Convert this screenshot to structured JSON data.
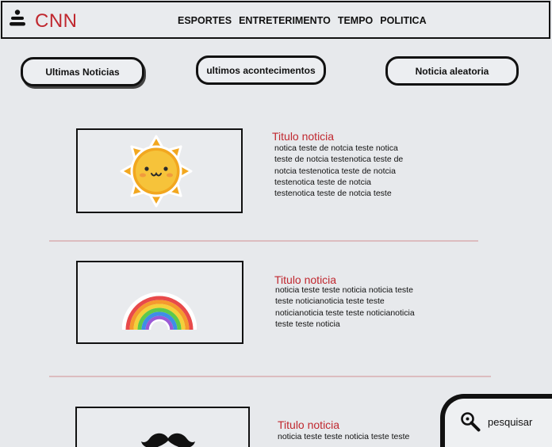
{
  "header": {
    "logo": "CNN",
    "nav": [
      "ESPORTES",
      "ENTRETERIMENTO",
      "TEMPO",
      "POLITICA"
    ]
  },
  "tabs": [
    "Ultimas Noticias",
    "ultimos acontecimentos",
    "Noticia aleatoria"
  ],
  "news": [
    {
      "title": "Titulo noticia",
      "body": [
        "notica teste de notcia teste notica",
        "teste de notcia testenotica teste de",
        "notcia testenotica teste de notcia",
        "testenotica teste de notcia",
        "testenotica teste de notcia teste"
      ],
      "image_icon": "sun-icon"
    },
    {
      "title": "Titulo noticia",
      "body": [
        "noticia teste teste noticia noticia teste",
        "teste noticianoticia teste teste",
        "noticianoticia teste teste noticianoticia",
        "teste teste noticia"
      ],
      "image_icon": "rainbow-icon"
    },
    {
      "title": "Titulo noticia",
      "body": [
        "noticia teste teste noticia teste teste"
      ],
      "image_icon": "mustache-icon"
    }
  ],
  "search": {
    "label": "pesquisar",
    "icon": "magnifier-icon"
  },
  "colors": {
    "brand_red": "#c0282f",
    "divider": "#dcbcbf",
    "background": "#e7e9ec"
  }
}
